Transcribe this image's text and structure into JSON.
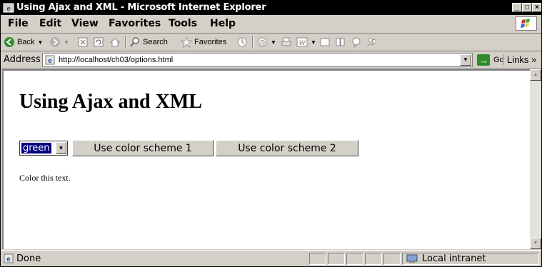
{
  "window": {
    "title": "Using Ajax and XML - Microsoft Internet Explorer",
    "minimize_label": "_",
    "maximize_label": "□",
    "close_label": "×"
  },
  "menu": {
    "items": [
      "File",
      "Edit",
      "View",
      "Favorites",
      "Tools",
      "Help"
    ]
  },
  "toolbar": {
    "back_label": "Back",
    "search_label": "Search",
    "favorites_label": "Favorites"
  },
  "address": {
    "label": "Address",
    "url": "http://localhost/ch03/options.html",
    "go_label": "Go",
    "links_label": "Links »"
  },
  "page": {
    "heading": "Using Ajax and XML",
    "scheme_select_value": "green",
    "button1_label": "Use color scheme 1",
    "button2_label": "Use color scheme 2",
    "color_text": "Color this text."
  },
  "status": {
    "text": "Done",
    "zone": "Local intranet"
  }
}
